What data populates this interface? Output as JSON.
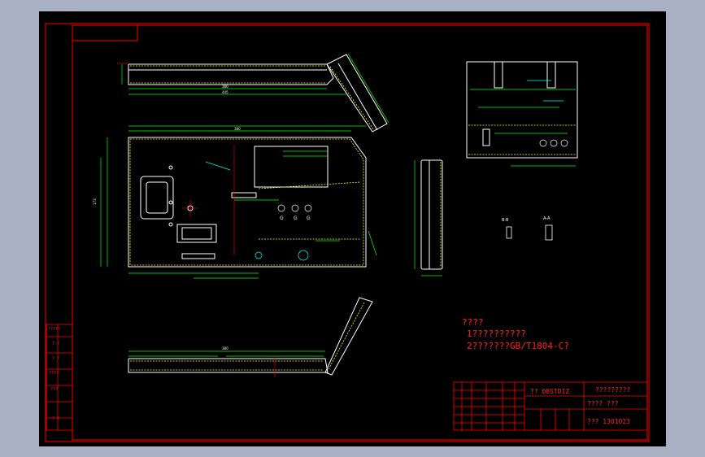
{
  "drawing": {
    "notes": {
      "heading": "????",
      "line1": "1??????????",
      "line2": "2???????GB/T1804-C?"
    },
    "title_block": {
      "material": "?? 08STDIZ",
      "title": "?????????",
      "scale_row": "????   ???",
      "drawing_no": "??? 1301023"
    },
    "side_labels": [
      "?????",
      "? ?",
      "? ?",
      "????",
      "???",
      "? ?"
    ],
    "section_labels": [
      "B-B",
      "A-A"
    ],
    "ground_symbol_labels": [
      "G",
      "G",
      "G"
    ],
    "colors": {
      "background": "#000000",
      "border": "#ff0000",
      "part_outline": "#ffffff",
      "hidden_line": "#ffff00",
      "dimension": "#00ff00",
      "center_line": "#ff0000",
      "annotation": "#00ffff"
    }
  }
}
